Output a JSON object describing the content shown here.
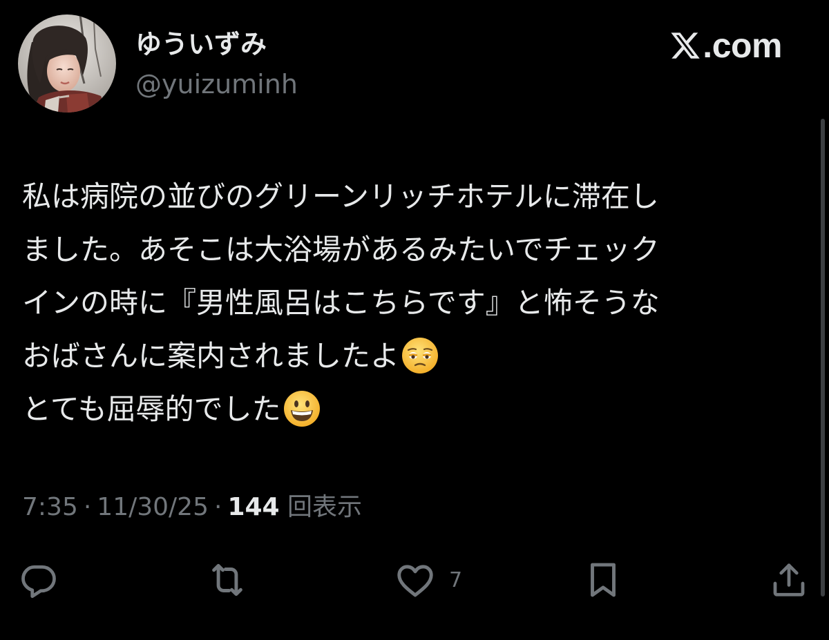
{
  "author": {
    "display_name": "ゆういずみ",
    "handle": "@yuizuminh"
  },
  "brand": {
    "text": ".com"
  },
  "tweet": {
    "lines": [
      "私は病院の並びのグリーンリッチホテルに滞在し",
      "ました。あそこは大浴場があるみたいでチェック",
      "インの時に『男性風呂はこちらです』と怖そうな",
      "おばさんに案内されましたよ",
      "とても屈辱的でした"
    ],
    "emoji": {
      "line4": "pleading-face-emoji",
      "line5": "grinning-face-emoji"
    }
  },
  "meta": {
    "time": "7:35",
    "separator": "·",
    "date": "11/30/25",
    "views_count": "144",
    "views_label": "回表示"
  },
  "actions": {
    "reply": {
      "icon": "reply-icon",
      "count": ""
    },
    "retweet": {
      "icon": "retweet-icon",
      "count": ""
    },
    "like": {
      "icon": "heart-icon",
      "count": "7"
    },
    "bookmark": {
      "icon": "bookmark-icon",
      "count": ""
    },
    "share": {
      "icon": "share-icon",
      "count": ""
    }
  },
  "colors": {
    "background": "#000000",
    "text_primary": "#e7e9ea",
    "text_secondary": "#71767b"
  }
}
